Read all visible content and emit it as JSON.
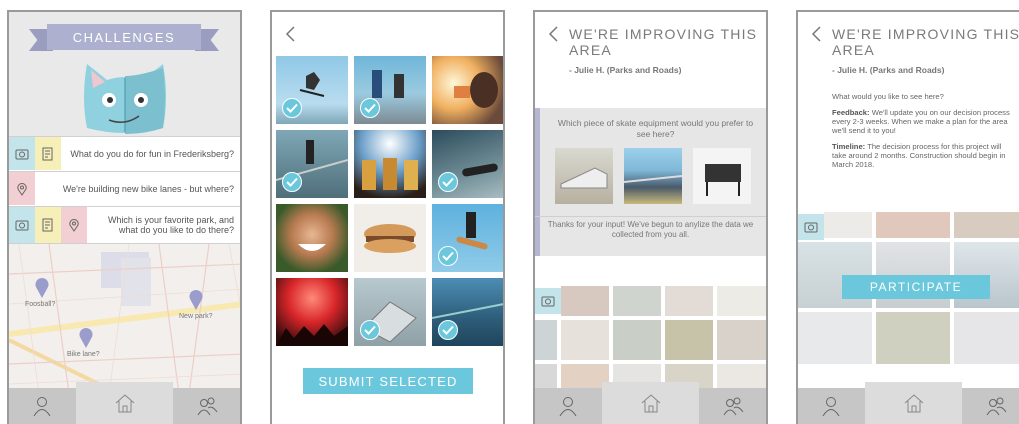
{
  "screen1": {
    "banner_title": "CHALLENGES",
    "rows": [
      {
        "text": "What do you do for fun in Frederiksberg?",
        "icons": [
          "camera-icon",
          "note-icon"
        ]
      },
      {
        "text": "We're building new bike lanes - but where?",
        "icons": [
          "map-pin-icon"
        ]
      },
      {
        "text": "Which is your favorite park, and what do you like to do there?",
        "icons": [
          "camera-icon",
          "note-icon",
          "map-pin-icon"
        ]
      }
    ],
    "map_pins": [
      "Foosball?",
      "New park?",
      "Bike lane?"
    ],
    "nav": [
      "profile-icon",
      "home-icon",
      "community-icon"
    ]
  },
  "screen2": {
    "submit_label": "SUBMIT SELECTED",
    "photos": [
      {
        "subject": "skater jumping",
        "selected": true
      },
      {
        "subject": "skaters on ramp",
        "selected": true
      },
      {
        "subject": "person drinking",
        "selected": false
      },
      {
        "subject": "skater on rail",
        "selected": true
      },
      {
        "subject": "beer glasses",
        "selected": false
      },
      {
        "subject": "skateboard close-up",
        "selected": true
      },
      {
        "subject": "smiling boy",
        "selected": false
      },
      {
        "subject": "burger",
        "selected": false
      },
      {
        "subject": "skater in air",
        "selected": true
      },
      {
        "subject": "concert crowd",
        "selected": false
      },
      {
        "subject": "skate ramp",
        "selected": true
      },
      {
        "subject": "skate park",
        "selected": true
      }
    ]
  },
  "screen3": {
    "title": "WE'RE IMPROVING THIS AREA",
    "subtitle": "- Julie H. (Parks and Roads)",
    "question": "Which piece of skate equipment would you prefer to see here?",
    "thanks": "Thanks for your input! We've begun to anylize the data we collected from you all."
  },
  "screen4": {
    "title": "WE'RE IMPROVING THIS AREA",
    "subtitle": "- Julie H. (Parks and Roads)",
    "intro": "What would you like to see here?",
    "feedback_label": "Feedback:",
    "feedback_text": "We'll update you on our decision process every 2-3 weeks. When we make a plan for the area we'll send it to you!",
    "timeline_label": "Timeline:",
    "timeline_text": "The decision process for this project will take around 2 months. Construction should begin in March 2018.",
    "participate_label": "PARTICIPATE"
  },
  "colors": {
    "accent": "#6bc8dc",
    "banner": "#aeb0cf",
    "nav": "#c6c6c6"
  }
}
